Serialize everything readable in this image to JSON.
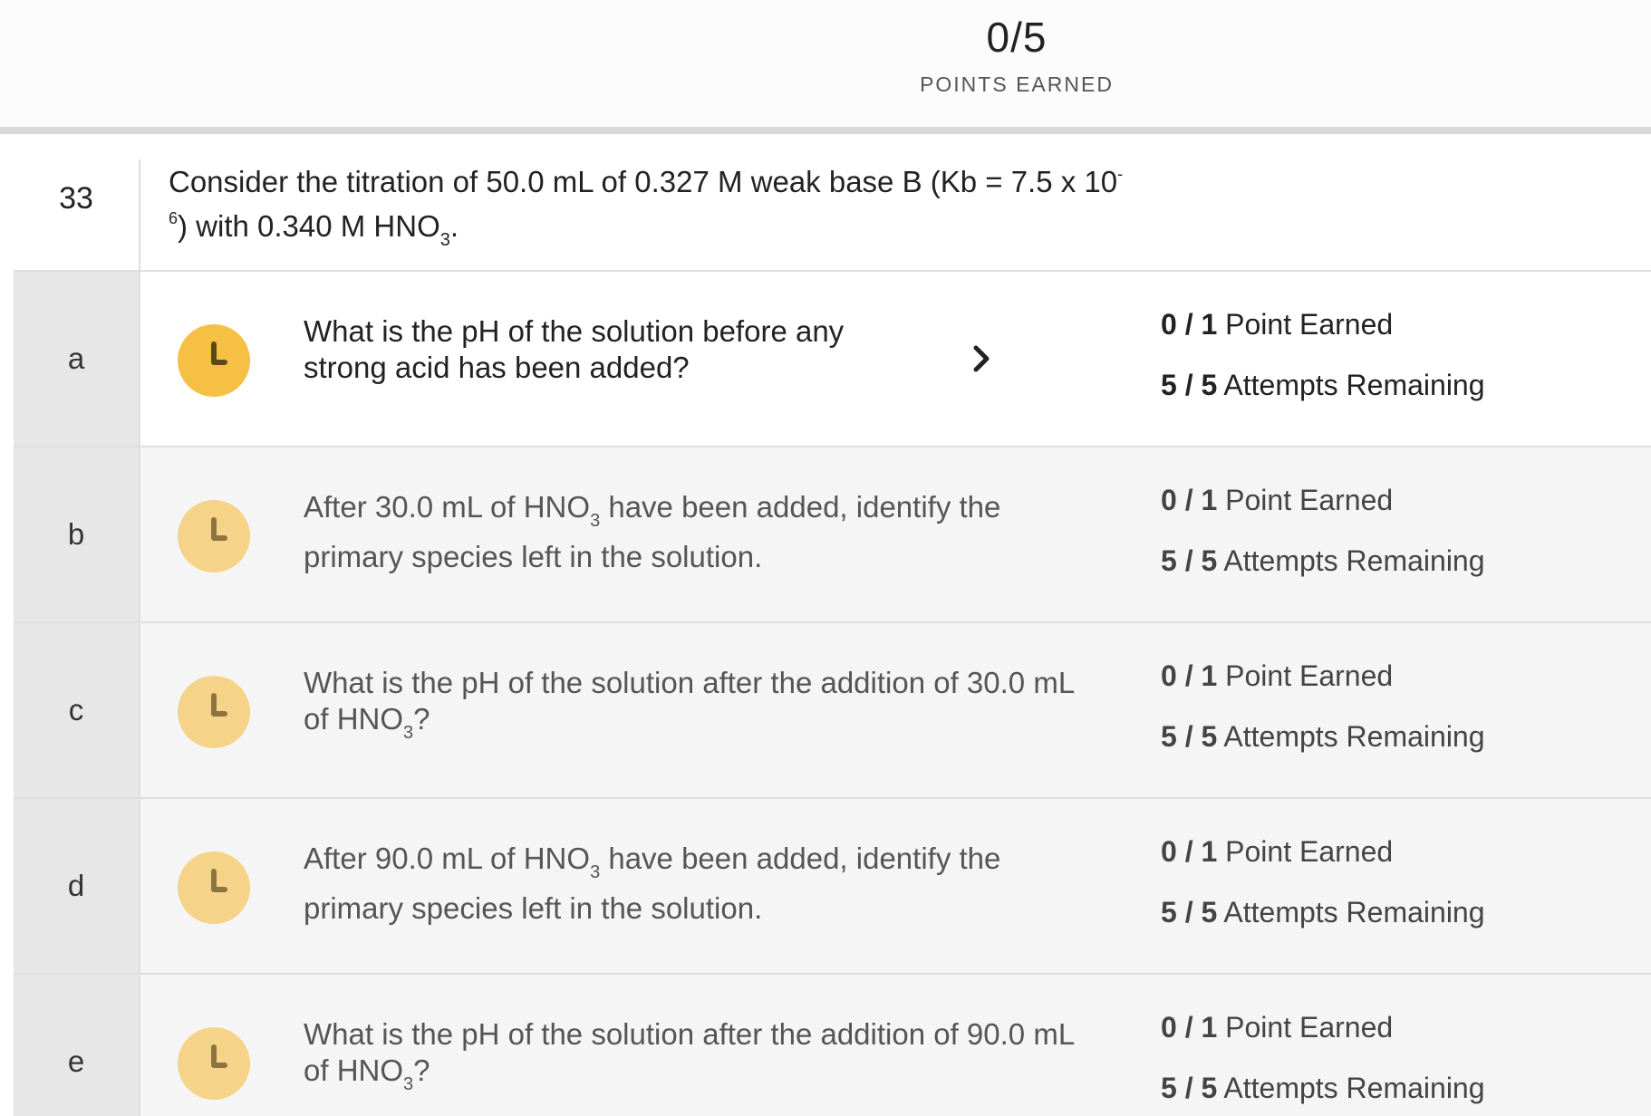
{
  "header": {
    "score": "0/5",
    "score_label": "POINTS EARNED"
  },
  "question": {
    "number": "33",
    "text_part1": "Consider the titration of 50.0 mL of 0.327 M weak base B (Kb = 7.5 x 10",
    "exponent": "-6",
    "text_part2": ") with 0.340 M HNO",
    "subscript": "3",
    "text_part3": "."
  },
  "parts": [
    {
      "letter": "a",
      "text_before": "What is the pH of the solution before any strong acid has been added?",
      "points_earned": "0 / 1",
      "points_label": " Point Earned",
      "attempts": "5 / 5",
      "attempts_label": " Attempts Remaining"
    },
    {
      "letter": "b",
      "text_before": "After 30.0 mL of HNO",
      "subscript": "3",
      "text_after": " have been added, identify the primary species left in the solution.",
      "points_earned": "0 / 1",
      "points_label": " Point Earned",
      "attempts": "5 / 5",
      "attempts_label": " Attempts Remaining"
    },
    {
      "letter": "c",
      "text_before": "What is the pH of the solution after the addition of 30.0 mL of HNO",
      "subscript": "3",
      "text_after": "?",
      "points_earned": "0 / 1",
      "points_label": " Point Earned",
      "attempts": "5 / 5",
      "attempts_label": " Attempts Remaining"
    },
    {
      "letter": "d",
      "text_before": "After 90.0 mL of HNO",
      "subscript": "3",
      "text_after": " have been added, identify the primary species left in the solution.",
      "points_earned": "0 / 1",
      "points_label": " Point Earned",
      "attempts": "5 / 5",
      "attempts_label": " Attempts Remaining"
    },
    {
      "letter": "e",
      "text_before": "What is the pH of the solution after the addition of 90.0 mL of HNO",
      "subscript": "3",
      "text_after": "?",
      "points_earned": "0 / 1",
      "points_label": " Point Earned",
      "attempts": "5 / 5",
      "attempts_label": " Attempts Remaining"
    }
  ],
  "icons": {
    "status": "clock-icon",
    "open": "chevron-right-icon"
  },
  "colors": {
    "clock_active": "#f6c044",
    "clock_inactive": "#f5d48a"
  }
}
